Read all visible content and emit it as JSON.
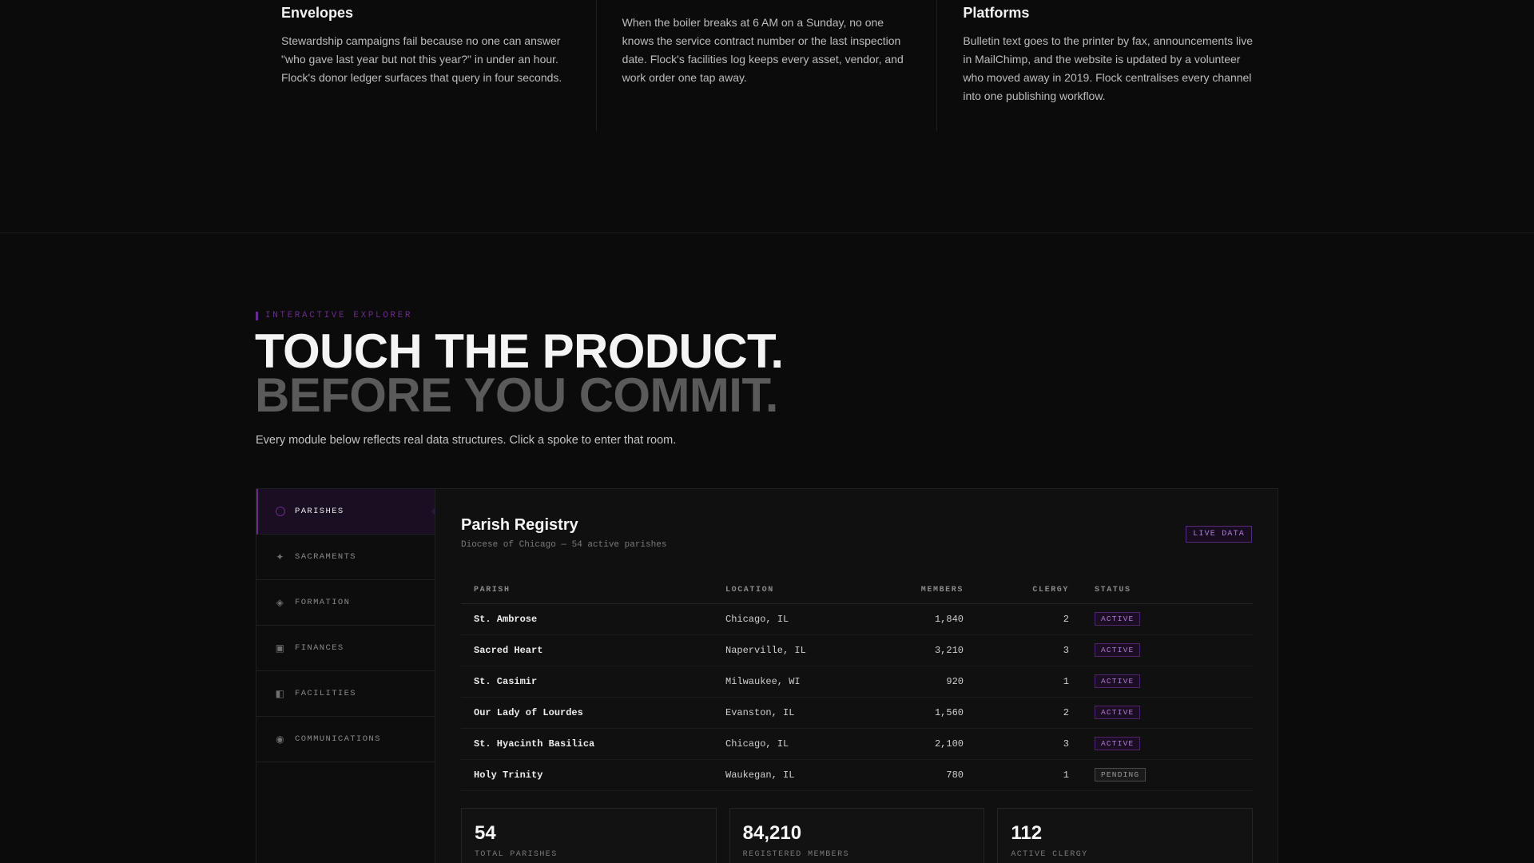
{
  "pain_points": [
    {
      "title": "Envelopes",
      "body": "Stewardship campaigns fail because no one can answer \"who gave last year but not this year?\" in under an hour. Flock's donor ledger surfaces that query in four seconds."
    },
    {
      "title": "",
      "body": "When the boiler breaks at 6 AM on a Sunday, no one knows the service contract number or the last inspection date. Flock's facilities log keeps every asset, vendor, and work order one tap away."
    },
    {
      "title": "Platforms",
      "body": "Bulletin text goes to the printer by fax, announcements live in MailChimp, and the website is updated by a volunteer who moved away in 2019. Flock centralises every channel into one publishing workflow."
    }
  ],
  "explorer": {
    "eyebrow": "INTERACTIVE EXPLORER",
    "headline_line1": "TOUCH THE PRODUCT.",
    "headline_line2": "BEFORE YOU COMMIT.",
    "lede": "Every module below reflects real data structures. Click a spoke to enter that room."
  },
  "sidebar": {
    "items": [
      {
        "label": "PARISHES",
        "icon": "ring-icon",
        "active": true
      },
      {
        "label": "SACRAMENTS",
        "icon": "sparkle-icon",
        "active": false
      },
      {
        "label": "FORMATION",
        "icon": "diamond-icon",
        "active": false
      },
      {
        "label": "FINANCES",
        "icon": "square-icon",
        "active": false
      },
      {
        "label": "FACILITIES",
        "icon": "half-square-icon",
        "active": false
      },
      {
        "label": "COMMUNICATIONS",
        "icon": "target-icon",
        "active": false
      }
    ]
  },
  "registry": {
    "title": "Parish Registry",
    "subtitle": "Diocese of Chicago — 54 active parishes",
    "badge": "LIVE DATA",
    "columns": [
      "PARISH",
      "LOCATION",
      "MEMBERS",
      "CLERGY",
      "STATUS"
    ],
    "rows": [
      {
        "parish": "St. Ambrose",
        "location": "Chicago, IL",
        "members": "1,840",
        "clergy": "2",
        "status": "ACTIVE"
      },
      {
        "parish": "Sacred Heart",
        "location": "Naperville, IL",
        "members": "3,210",
        "clergy": "3",
        "status": "ACTIVE"
      },
      {
        "parish": "St. Casimir",
        "location": "Milwaukee, WI",
        "members": "920",
        "clergy": "1",
        "status": "ACTIVE"
      },
      {
        "parish": "Our Lady of Lourdes",
        "location": "Evanston, IL",
        "members": "1,560",
        "clergy": "2",
        "status": "ACTIVE"
      },
      {
        "parish": "St. Hyacinth Basilica",
        "location": "Chicago, IL",
        "members": "2,100",
        "clergy": "3",
        "status": "ACTIVE"
      },
      {
        "parish": "Holy Trinity",
        "location": "Waukegan, IL",
        "members": "780",
        "clergy": "1",
        "status": "PENDING"
      }
    ],
    "stats": [
      {
        "value": "54",
        "label": "TOTAL PARISHES"
      },
      {
        "value": "84,210",
        "label": "REGISTERED MEMBERS"
      },
      {
        "value": "112",
        "label": "ACTIVE CLERGY"
      }
    ]
  },
  "colors": {
    "accent": "#6c2a8c",
    "background": "#0b0b0b"
  }
}
